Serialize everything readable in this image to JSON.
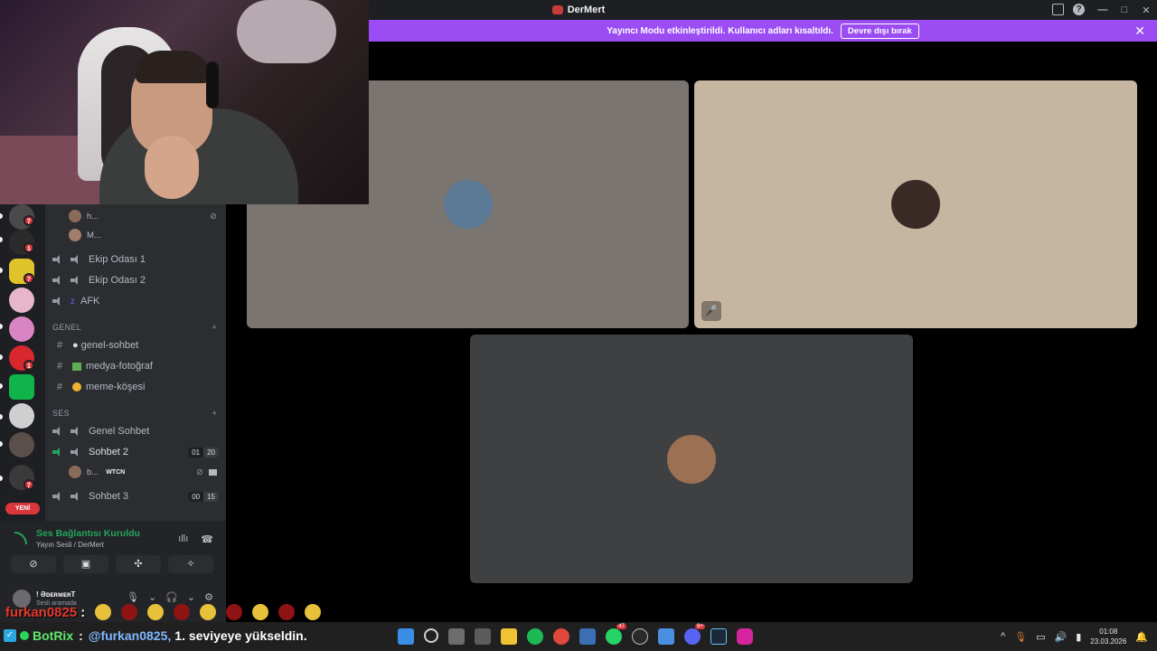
{
  "window": {
    "title": "DerMert",
    "controls": [
      "—",
      "□",
      "✕"
    ]
  },
  "notice": {
    "text": "Yayıncı Modu etkinleştirildi. Kullanıcı adları kısaltıldı.",
    "button": "Devre dışı bırak",
    "close": "✕"
  },
  "servers": {
    "badges": [
      "7",
      "1",
      "7",
      "1",
      "1",
      "7"
    ],
    "new_pill": "YENİ"
  },
  "channels": {
    "top_users": [
      {
        "name": "h..."
      },
      {
        "name": "M..."
      }
    ],
    "voice_top": [
      {
        "label": "Ekip Odası 1"
      },
      {
        "label": "Ekip Odası 2"
      },
      {
        "label": "AFK"
      }
    ],
    "cat_genel": "GENEL",
    "text_channels": [
      {
        "label": "genel-sohbet"
      },
      {
        "label": "medya-fotoğraf"
      },
      {
        "label": "meme-köşesi"
      }
    ],
    "cat_ses": "SES",
    "voice_channels": [
      {
        "label": "Genel Sohbet"
      },
      {
        "label": "Sohbet 2",
        "count_a": "01",
        "count_b": "20"
      },
      {
        "label": "Sohbet 3",
        "count_a": "00",
        "count_b": "15"
      }
    ],
    "sohbet2_user": {
      "name": "b...",
      "tag": "WTCN"
    }
  },
  "voice_panel": {
    "status": "Ses Bağlantısı Kuruldu",
    "sub": "Yayın Sesli / DerMert",
    "user_name": "! ƏᴅᴇʀᴍᴇʀT",
    "user_status": "Sesli aramada"
  },
  "stage": {
    "tiles": [
      {
        "bg": "#7b7571",
        "avatar": "#5c7a95"
      },
      {
        "bg": "#c6b5a0",
        "avatar": "#3a2a25"
      },
      {
        "bg": "#3f4042",
        "avatar": "#9c7052"
      }
    ]
  },
  "chat_overlay": {
    "user": "furkan0825",
    "sep": ":",
    "bot_name": "BotRix",
    "bot_sep": ":",
    "mention": "@furkan0825,",
    "message": "1. seviyeye yükseldin."
  },
  "taskbar": {
    "badges": {
      "whatsapp": "47",
      "discord": "9+"
    },
    "time": "01:08",
    "date": "23.03.2026"
  },
  "colors": {
    "accent_purple": "#9b4df3",
    "voice_green": "#23a55a",
    "danger_red": "#da373c"
  }
}
